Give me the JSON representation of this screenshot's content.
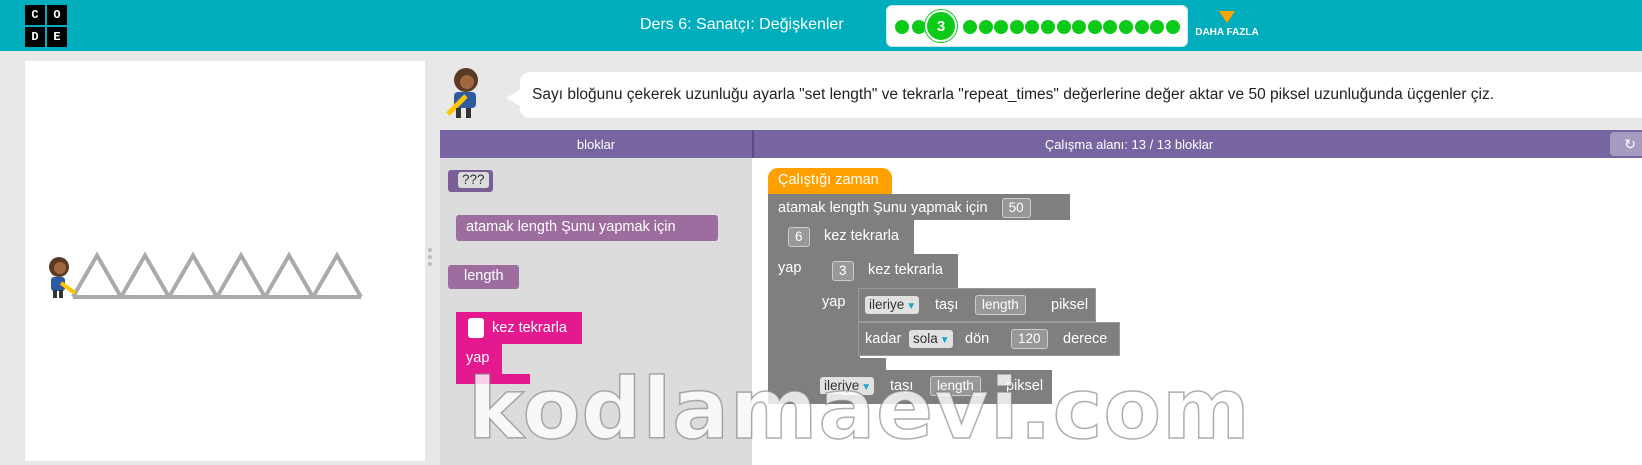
{
  "header": {
    "logo_letters": [
      "C",
      "O",
      "D",
      "E"
    ],
    "lesson_title": "Ders 6: Sanatçı: Değişkenler",
    "progress": {
      "current_level": "3",
      "total_dots": 17
    },
    "more_label": "DAHA FAZLA"
  },
  "instructions": {
    "text": "Sayı bloğunu çekerek uzunluğu ayarla \"set length\" ve tekrarla \"repeat_times\" değerlerine değer aktar ve 50 piksel uzunluğunda üçgenler çiz."
  },
  "workspace_header": {
    "toolbox_title": "bloklar",
    "workspace_title": "Çalışma alanı: 13 / 13 bloklar",
    "reset_icon": "undo-icon"
  },
  "toolbox": {
    "block_unknown": "???",
    "block_set_var": "atamak  length  Şunu yapmak için",
    "block_get_var": "length",
    "block_repeat_label": "kez tekrarla",
    "block_repeat_do": "yap"
  },
  "program": {
    "when_run": "Çalıştığı zaman",
    "set_prefix": "atamak  length  Şunu yapmak için",
    "set_value": "50",
    "outer_repeat_count": "6",
    "repeat_label": "kez tekrarla",
    "do_label": "yap",
    "inner_repeat_count": "3",
    "move_dir": "ileriye",
    "move_label": "taşı",
    "length_var": "length",
    "pixel_label": "piksel",
    "turn_prefix": "kadar",
    "turn_dir": "sola",
    "turn_label": "dön",
    "turn_value": "120",
    "degree_label": "derece",
    "move2_dir": "ileriye",
    "move2_label": "taşı",
    "pixel2_label": "piksel"
  },
  "watermark": "kodlamaevi.com",
  "colors": {
    "header": "#00adbc",
    "progress_dot": "#0ccb18",
    "workspace_header": "#7665a0",
    "block_gray": "#7f7f7f",
    "block_pink": "#e4188f",
    "block_orange": "#ffa000",
    "block_purple": "#9d6da0"
  }
}
